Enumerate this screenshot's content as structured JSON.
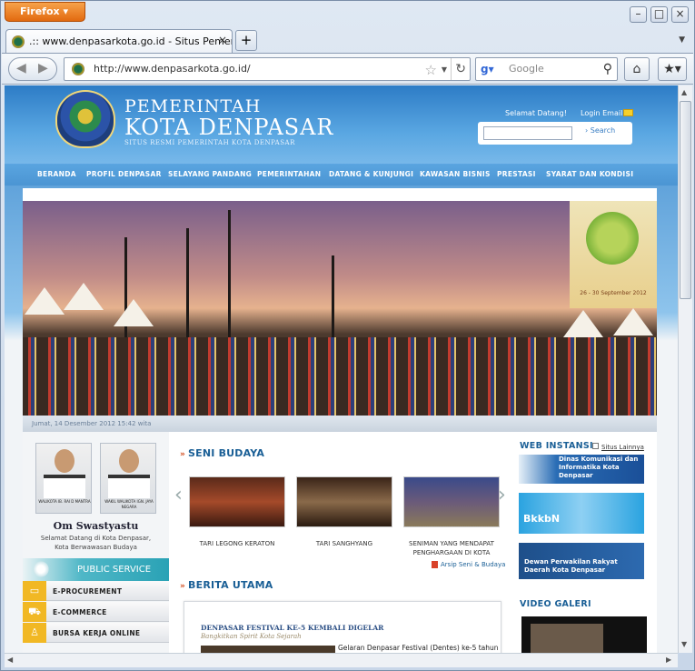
{
  "browser": {
    "app_button": "Firefox",
    "tab_title": ".:: www.denpasarkota.go.id - Situs Pemerin...",
    "url": "http://www.denpasarkota.go.id/",
    "search_placeholder": "Google"
  },
  "site": {
    "title_line1": "PEMERINTAH",
    "title_line2": "KOTA DENPASAR",
    "title_line3": "SITUS RESMI PEMERINTAH KOTA DENPASAR",
    "welcome": "Selamat Datang!",
    "login_email": "Login Email",
    "search_button": "Search",
    "menu": [
      "BERANDA",
      "PROFIL DENPASAR",
      "SELAYANG PANDANG",
      "PEMERINTAHAN",
      "DATANG & KUNJUNGI",
      "KAWASAN BISNIS",
      "PRESTASI",
      "SYARAT DAN KONDISI"
    ],
    "date": "Jumat, 14 Desember 2012 15:42 wita",
    "poster_text": "26 - 30 September 2012",
    "officials": [
      {
        "caption": "WALIKOTA IB. RAI D MANTRA"
      },
      {
        "caption": "WAKIL WALIKOTA IGN. JAYA NEGARA"
      }
    ],
    "greeting": "Om Swastyastu",
    "greeting_sub1": "Selamat Datang di Kota Denpasar,",
    "greeting_sub2": "Kota Berwawasan Budaya",
    "public_service": "PUBLIC SERVICE",
    "left_menu": [
      "E-PROCUREMENT",
      "E-COMMERCE",
      "BURSA KERJA ONLINE"
    ],
    "seni_budaya": "SENI BUDAYA",
    "seni_items": [
      "TARI LEGONG KERATON",
      "TARI SANGHYANG",
      "SENIMAN YANG MENDAPAT PENGHARGAAN DI KOTA"
    ],
    "arsip": "Arsip Seni & Budaya",
    "berita_utama": "BERITA UTAMA",
    "news_title": "DENPASAR FESTIVAL KE-5 KEMBALI DIGELAR",
    "news_sub": "Bangkitkan Spirit Kota Sejarah",
    "news_text": "Gelaran Denpasar Festival (Dentes) ke-5 tahun",
    "web_instansi": "WEB INSTANSI",
    "situs_lainnya": "Situs Lainnya",
    "instansi": [
      "Dinas Komunikasi dan Informatika Kota Denpasar",
      "BkkbN",
      "Dewan Perwakilan Rakyat Daerah Kota Denpasar"
    ],
    "video_galeri": "VIDEO GALERI"
  },
  "colors": {
    "accent": "#1a5f96",
    "menu": "#4b95d3",
    "public_service": "#2aa2b5",
    "icon_yellow": "#f1b824"
  }
}
